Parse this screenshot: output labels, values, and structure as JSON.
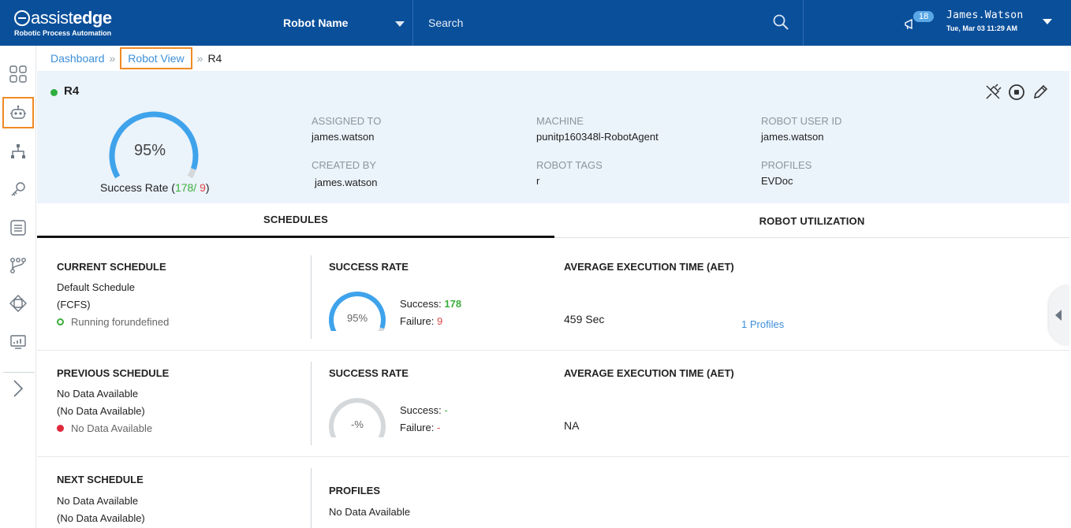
{
  "app": {
    "logo_light": "assist",
    "logo_bold": "edge",
    "logo_subtitle": "Robotic Process Automation"
  },
  "topbar": {
    "robot_select_label": "Robot Name",
    "search_placeholder": "Search",
    "notification_count": "18",
    "user_name": "James.Watson",
    "user_datetime": "Tue, Mar 03 11:29 AM"
  },
  "breadcrumb": {
    "dashboard": "Dashboard",
    "robot_view": "Robot View",
    "current": "R4"
  },
  "robot": {
    "name": "R4",
    "status_color": "#2eae3e",
    "success_rate_pct": "95%",
    "success_rate_value": 95,
    "success_rate_label": "Success Rate",
    "success_count": "178",
    "failure_count": "9",
    "assigned_to_label": "ASSIGNED TO",
    "assigned_to": "james.watson",
    "created_by_label": "CREATED BY",
    "created_by": "james.watson",
    "machine_label": "MACHINE",
    "machine": "punitp160348l-RobotAgent",
    "robot_tags_label": "ROBOT TAGS",
    "robot_tags": "r",
    "robot_user_id_label": "ROBOT USER ID",
    "robot_user_id": "james.watson",
    "profiles_label": "PROFILES",
    "profiles": "EVDoc"
  },
  "tabs": {
    "schedules": "SCHEDULES",
    "robot_utilization": "ROBOT UTILIZATION"
  },
  "current_schedule": {
    "title": "CURRENT SCHEDULE",
    "name": "Default Schedule",
    "mode": "(FCFS)",
    "status": "Running forundefined",
    "success_rate_title": "SUCCESS RATE",
    "gauge_pct": "95%",
    "gauge_value": 95,
    "success_label": "Success:",
    "success_value": "178",
    "failure_label": "Failure:",
    "failure_value": "9",
    "aet_title": "AVERAGE EXECUTION TIME (AET)",
    "aet_value": "459 Sec",
    "profiles_link": "1 Profiles"
  },
  "previous_schedule": {
    "title": "PREVIOUS SCHEDULE",
    "name": "No Data Available",
    "mode": "(No Data Available)",
    "status": "No Data Available",
    "success_rate_title": "SUCCESS RATE",
    "gauge_pct": "-%",
    "success_label": "Success:",
    "success_value": "-",
    "failure_label": "Failure:",
    "failure_value": "-",
    "aet_title": "AVERAGE EXECUTION TIME (AET)",
    "aet_value": "NA"
  },
  "next_schedule": {
    "title": "NEXT SCHEDULE",
    "name": "No Data Available",
    "mode": "(No Data Available)",
    "profiles_title": "PROFILES",
    "profiles_value": "No Data Available"
  },
  "colors": {
    "topbar": "#0a4f9a",
    "accent_blue": "#3d8fd8",
    "highlight_orange": "#f08a24",
    "success_green": "#3cae3c",
    "failure_red": "#e04848",
    "gauge_blue": "#3fa3ec",
    "gauge_gray": "#d5d8db"
  },
  "icons": {
    "sidebar": [
      "dashboard-grid-icon",
      "robot-icon",
      "hierarchy-icon",
      "key-icon",
      "list-icon",
      "workflow-icon",
      "chip-icon",
      "monitor-chart-icon",
      "chevron-right-icon"
    ],
    "header_actions": [
      "unplug-icon",
      "stop-icon",
      "edit-pencil-icon"
    ]
  }
}
